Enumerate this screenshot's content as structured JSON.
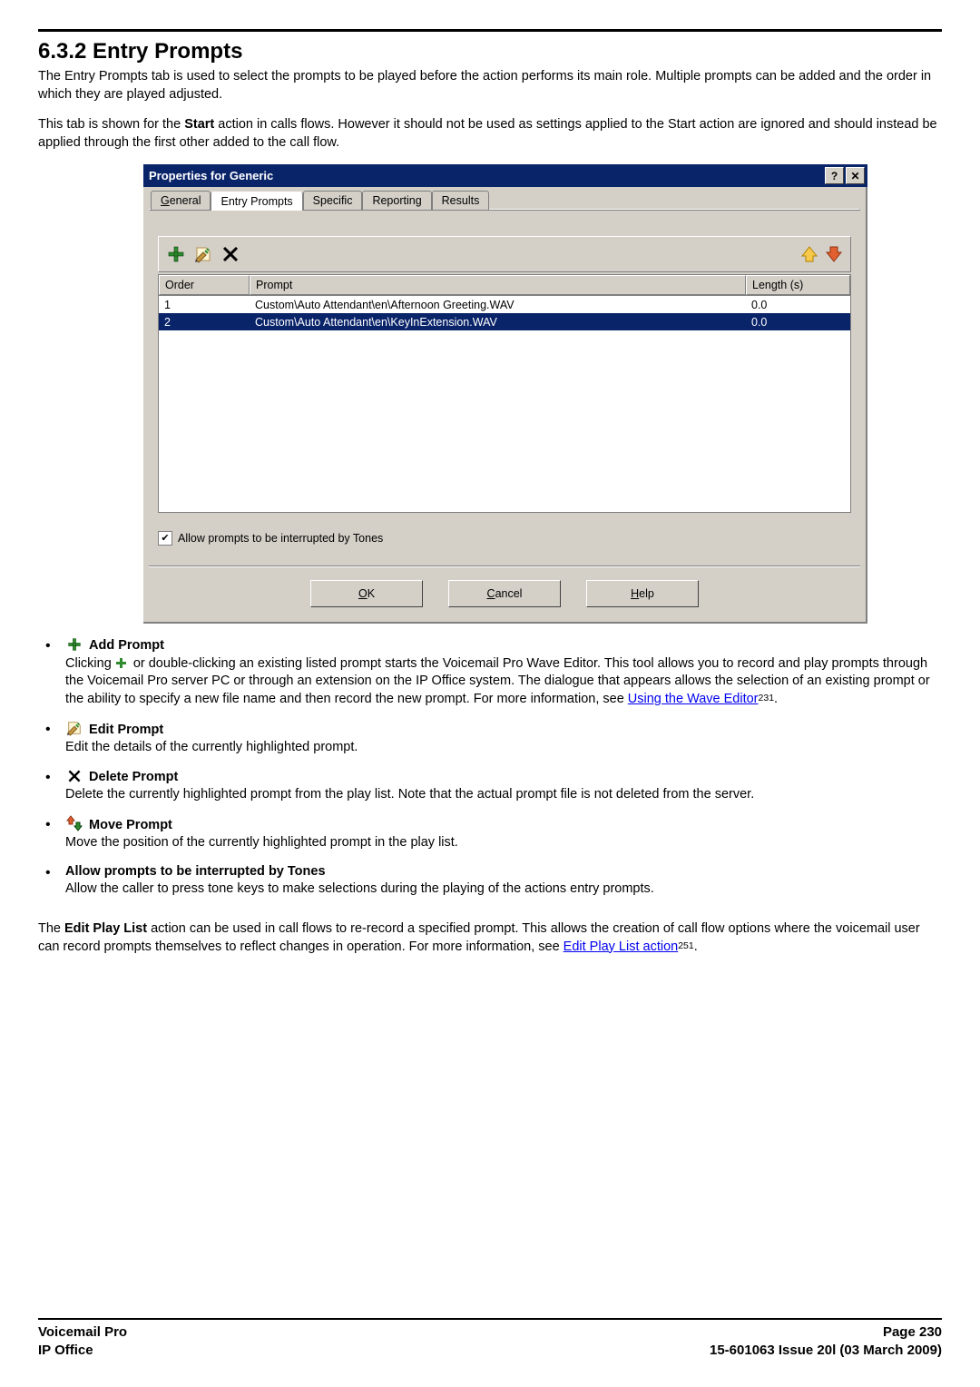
{
  "section": {
    "title": "6.3.2 Entry Prompts",
    "para1": "The Entry Prompts tab is used to select the prompts to be played before the action performs its main role. Multiple prompts can be added and the order in which they are played adjusted.",
    "para2_a": "This tab is shown for the ",
    "para2_b": "Start",
    "para2_c": " action in calls flows. However it should not be used as settings applied to the Start action are ignored and should instead be applied through the first other added to the call flow."
  },
  "dialog": {
    "title": "Properties for Generic",
    "help_btn": "?",
    "close_btn": "✕",
    "tabs": {
      "general_pre": "G",
      "general_post": "eneral",
      "entry": "Entry Prompts",
      "specific": "Specific",
      "reporting": "Reporting",
      "results": "Results"
    },
    "table": {
      "headers": {
        "order": "Order",
        "prompt": "Prompt",
        "length": "Length (s)"
      },
      "rows": [
        {
          "order": "1",
          "prompt": "Custom\\Auto Attendant\\en\\Afternoon Greeting.WAV",
          "length": "0.0",
          "selected": false
        },
        {
          "order": "2",
          "prompt": "Custom\\Auto Attendant\\en\\KeyInExtension.WAV",
          "length": "0.0",
          "selected": true
        }
      ]
    },
    "checkbox_label": "Allow prompts to be interrupted by Tones",
    "buttons": {
      "ok_pre": "O",
      "ok_post": "K",
      "cancel_pre": "C",
      "cancel_post": "ancel",
      "help_pre": "H",
      "help_post": "elp"
    }
  },
  "features": {
    "add": {
      "title": "Add Prompt",
      "p_a": "Clicking ",
      "p_b": " or double-clicking an existing listed prompt starts the Voicemail Pro Wave Editor. This tool allows you to record and play prompts through the Voicemail Pro server PC or through an extension on the IP Office system. The dialogue that appears allows the selection of an existing prompt or the ability to specify a new file name and then record the new prompt. For more information, see ",
      "link": "Using the Wave Editor",
      "ref": "231",
      "p_c": "."
    },
    "edit": {
      "title": "Edit Prompt",
      "body": "Edit the details of the currently highlighted prompt."
    },
    "delete": {
      "title": "Delete Prompt",
      "body": "Delete the currently highlighted prompt from the play list. Note that the actual prompt file is not deleted from the server."
    },
    "move": {
      "title": "Move Prompt",
      "body": "Move the position of the currently highlighted prompt in the play list."
    },
    "allow": {
      "title": "Allow prompts to be interrupted by Tones",
      "body": "Allow the caller to press tone keys to make selections during the playing of the actions entry prompts."
    }
  },
  "closing": {
    "p_a": "The ",
    "p_b": "Edit Play List",
    "p_c": " action can be used in call flows to re-record a specified prompt. This allows the creation of call flow options where the voicemail user can record prompts themselves to reflect changes in operation. For more information, see ",
    "link": "Edit Play List action",
    "ref": "251",
    "p_d": "."
  },
  "footer": {
    "left1": "Voicemail Pro",
    "left2": "IP Office",
    "right1": "Page 230",
    "right2": "15-601063 Issue 20l (03 March 2009)"
  }
}
